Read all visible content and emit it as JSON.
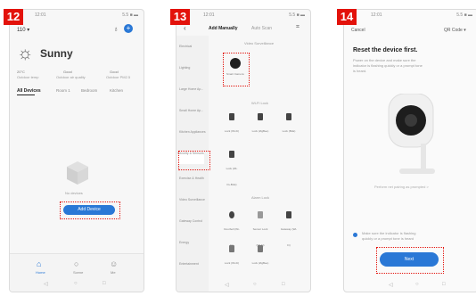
{
  "steps": [
    "12",
    "13",
    "14"
  ],
  "colors": {
    "highlight": "#e3120b",
    "accent": "#2a78d6"
  },
  "panel1": {
    "status_time": "12:01",
    "status_right": "5.5 ■ ▬",
    "header_left": "110 ▾",
    "home_name": "Sunny",
    "weather": [
      {
        "value": "20°C",
        "label": "Outdoor temp"
      },
      {
        "value": "Good",
        "label": "Outdoor air quality"
      },
      {
        "value": "Good",
        "label": "Outdoor PM2.5"
      }
    ],
    "tabs": [
      "All Devices",
      "Room 1",
      "Bedroom",
      "Kitchen"
    ],
    "empty_text": "No devices",
    "add_button": "Add Device",
    "nav": [
      "Home",
      "Scene",
      "Me"
    ]
  },
  "panel2": {
    "status_time": "12:01",
    "status_right": "5.5 ■ ▬",
    "tab_manual": "Add Manually",
    "tab_auto": "Auto Scan",
    "sidebar": [
      "Electrical",
      "Lighting",
      "Large Home Ap...",
      "Small Home Ap...",
      "Kitchen Appliances",
      "Security & Sensors",
      "Exercise & Health",
      "Video Surveillance",
      "Gateway Control",
      "Energy",
      "Entertainment"
    ],
    "section1": "Video Surveillance",
    "camera_label": "Smart Camera",
    "section2": "Wi-Fi Lock",
    "locks": [
      "Lock (Wi-Fi)",
      "Lock (ZigBee)",
      "Lock (BLE)",
      "Lock (Wi-Fi+BLE)"
    ],
    "section3": "Alarm Lock",
    "alarms": [
      "Doorbell (Wi-Fi)",
      "Sensor Lock (Wi-Fi)",
      "Gateway (Wi-Fi)",
      "Lock (Wi-Fi)",
      "Lock (ZigBee)",
      "Lock (Wi-Fi)"
    ]
  },
  "panel3": {
    "status_time": "12:01",
    "status_right": "5.5 ■ ▬",
    "cancel": "Cancel",
    "qr_code": "QR Code ▾",
    "title": "Reset the device first.",
    "instructions": [
      "Power on the device and make sure the",
      "indicator is flashing quickly or a prompt tone",
      "is heard."
    ],
    "hint": "Perform net pairing as prompted >",
    "confirm": [
      "Make sure the indicator is flashing",
      "quickly or a prompt tone is heard"
    ],
    "next": "Next"
  }
}
